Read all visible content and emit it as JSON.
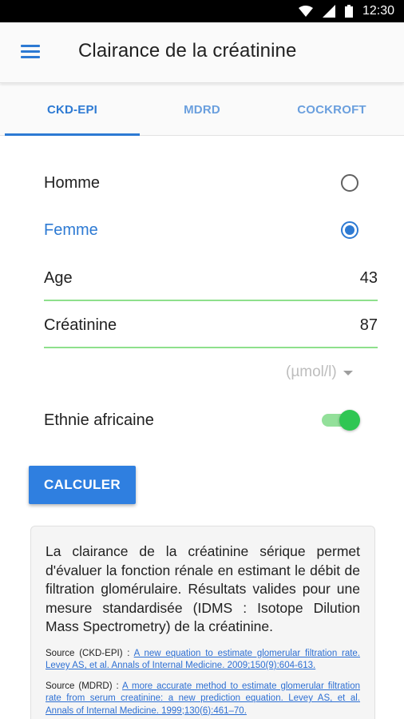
{
  "status_bar": {
    "time": "12:30",
    "icons": [
      "wifi-icon",
      "cell-signal-icon",
      "battery-icon"
    ]
  },
  "app_bar": {
    "menu_icon": "hamburger-menu-icon",
    "title": "Clairance de la créatinine"
  },
  "tabs": [
    {
      "label": "CKD-EPI",
      "active": true
    },
    {
      "label": "MDRD",
      "active": false
    },
    {
      "label": "COCKROFT",
      "active": false
    }
  ],
  "form": {
    "sex_options": [
      {
        "label": "Homme",
        "selected": false
      },
      {
        "label": "Femme",
        "selected": true
      }
    ],
    "age": {
      "label": "Age",
      "value": "43"
    },
    "creatinine": {
      "label": "Créatinine",
      "value": "87"
    },
    "unit": {
      "selected": "(µmol/l)"
    },
    "ethnicity": {
      "label": "Ethnie africaine",
      "enabled": true
    }
  },
  "calculate_button": "CALCULER",
  "info": {
    "text": "La clairance de la créatinine sérique permet d'évaluer la fonction rénale en estimant le débit de filtration glomérulaire. Résultats valides pour une mesure standardisée (IDMS : Isotope Dilution Mass Spectrometry) de la créatinine.",
    "sources": [
      {
        "prefix": "Source (CKD-EPI) : ",
        "link": "A new equation to estimate glomerular filtration rate. Levey AS, et al. Annals of Internal Medicine. 2009;150(9):604-613."
      },
      {
        "prefix": "Source (MDRD) : ",
        "link": "A more accurate method to estimate glomerular filtration rate from serum creatinine: a new prediction equation. Levey AS, et al. Annals of Internal Medicine. 1999;130(6):461–70."
      }
    ]
  },
  "colors": {
    "accent": "#2d7ad3",
    "field_underline": "#8ee08c",
    "switch_thumb": "#2fc653",
    "switch_track": "#93e09a",
    "button": "#2f7fe0"
  }
}
